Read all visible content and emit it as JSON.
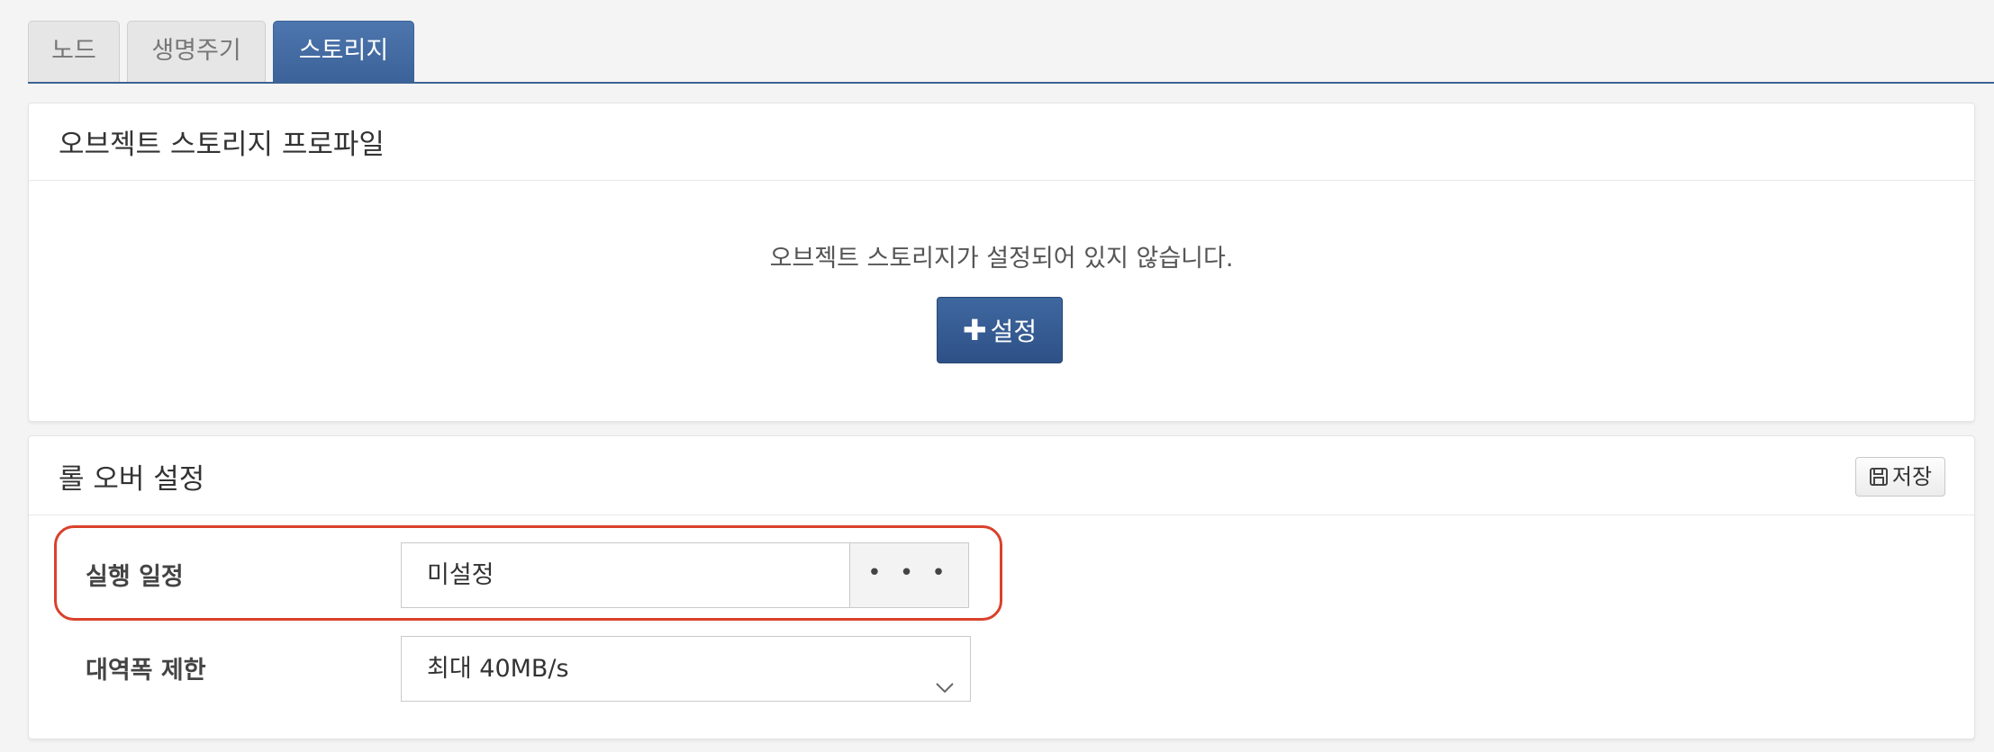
{
  "tabs": [
    {
      "label": "노드",
      "active": false
    },
    {
      "label": "생명주기",
      "active": false
    },
    {
      "label": "스토리지",
      "active": true
    }
  ],
  "object_storage": {
    "title": "오브젝트 스토리지 프로파일",
    "empty_message": "오브젝트 스토리지가 설정되어 있지 않습니다.",
    "setup_button": "설정",
    "setup_icon": "plus-icon"
  },
  "rollover": {
    "title": "롤 오버 설정",
    "save_button": "저장",
    "save_icon": "floppy-disk-icon",
    "schedule": {
      "label": "실행 일정",
      "value": "미설정",
      "picker_button": "• • •"
    },
    "bandwidth": {
      "label": "대역폭 제한",
      "selected": "최대 40MB/s"
    }
  },
  "colors": {
    "accent": "#3b6399",
    "highlight": "#d9412b"
  }
}
